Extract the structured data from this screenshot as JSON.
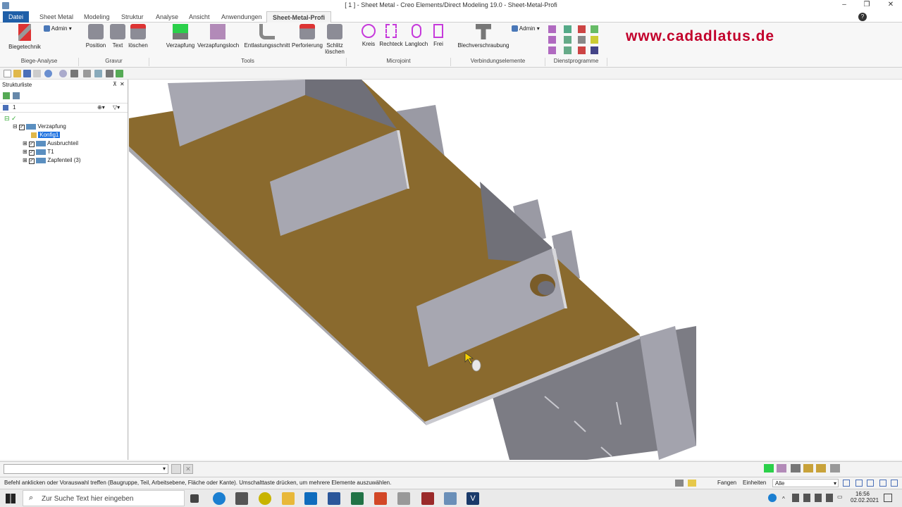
{
  "window": {
    "title": "[ 1 ] - Sheet Metal - Creo Elements/Direct Modeling 19.0 - Sheet-Metal-Profi",
    "watermark": "www.cadadlatus.de"
  },
  "tabs": [
    {
      "label": "Datei"
    },
    {
      "label": "Sheet Metal"
    },
    {
      "label": "Modeling"
    },
    {
      "label": "Struktur"
    },
    {
      "label": "Analyse"
    },
    {
      "label": "Ansicht"
    },
    {
      "label": "Anwendungen"
    },
    {
      "label": "Sheet-Metal-Profi"
    }
  ],
  "ribbon": {
    "buttons": {
      "biegetechnik": "Biegetechnik",
      "admin1": "Admin",
      "position": "Position",
      "text": "Text",
      "loeschen": "löschen",
      "verzapfung": "Verzapfung",
      "verzapfungsloch": "Verzapfungsloch",
      "entlastungsschnitt": "Entlastungsschnitt",
      "perforierung": "Perforierung",
      "schlitz1": "Schlitz",
      "schlitz2": "löschen",
      "kreis": "Kreis",
      "rechteck": "Rechteck",
      "langloch": "Langloch",
      "frei": "Frei",
      "blechverschraubung": "Blechverschraubung",
      "admin2": "Admin"
    },
    "groups": {
      "biege_analyse": "Biege-Analyse",
      "gravur": "Gravur",
      "tools": "Tools",
      "microjoint": "Microjoint",
      "verbindungselemente": "Verbindungselemente",
      "dienstprogramme": "Dienstprogramme"
    }
  },
  "panel": {
    "title": "Strukturliste",
    "counter": "1",
    "tree": [
      {
        "label": "Verzapfung"
      },
      {
        "label": "Konfig1"
      },
      {
        "label": "Ausbruchteil"
      },
      {
        "label": "T1"
      },
      {
        "label": "Zapfenteil (3)"
      }
    ]
  },
  "statusbar": {
    "message": "Befehl anklicken oder Vorauswahl treffen (Baugruppe, Teil, Arbeitsebene, Fläche oder Kante). Umschalttaste drücken, um mehrere Elemente auszuwählen.",
    "fangen": "Fangen",
    "einheiten": "Einheiten",
    "filter": "Alle"
  },
  "taskbar": {
    "search_placeholder": "Zur Suche Text hier eingeben",
    "time": "16:56",
    "date": "02.02.2021"
  },
  "colors": {
    "plate": "#8a6a2e",
    "flange": "#a9a9b4",
    "accent": "#1f5fa8",
    "watermark": "#c2002b"
  }
}
